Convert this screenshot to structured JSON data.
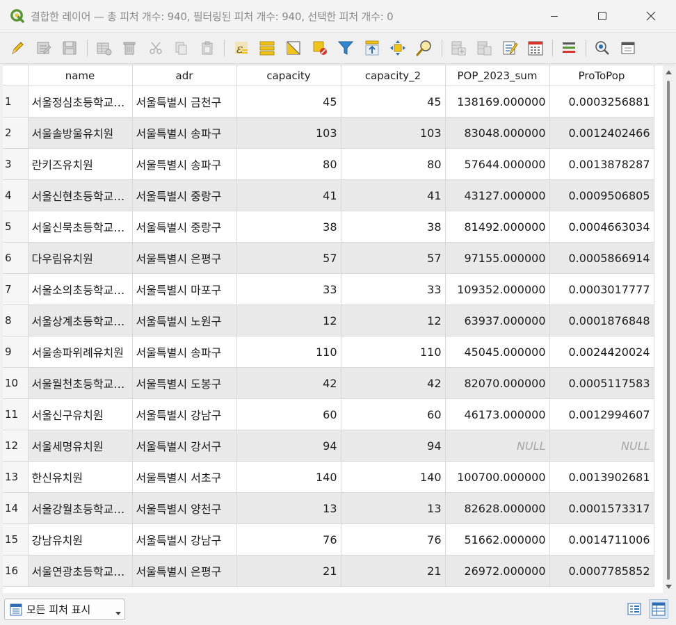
{
  "window": {
    "title": "결합한 레이어 — 총 피처 개수: 940, 필터링된 피처 개수: 940, 선택한 피처 개수: 0"
  },
  "toolbar": {
    "buttons": [
      {
        "id": "toggle-editing",
        "icon": "pencil-icon"
      },
      {
        "id": "toggle-multi-edit",
        "icon": "multi-edit-icon"
      },
      {
        "id": "save-edits",
        "icon": "save-icon"
      },
      {
        "id": "reload-table",
        "icon": "reload-icon"
      },
      {
        "id": "delete-features",
        "icon": "trash-icon"
      },
      {
        "id": "cut-features",
        "icon": "scissors-icon"
      },
      {
        "id": "copy-features",
        "icon": "copy-icon"
      },
      {
        "id": "paste-features",
        "icon": "paste-icon"
      },
      {
        "id": "select-by-expression",
        "icon": "expression-select-icon"
      },
      {
        "id": "select-all",
        "icon": "select-all-icon"
      },
      {
        "id": "invert-selection",
        "icon": "invert-selection-icon"
      },
      {
        "id": "deselect-all",
        "icon": "deselect-icon"
      },
      {
        "id": "filter-select",
        "icon": "filter-icon"
      },
      {
        "id": "move-selection-top",
        "icon": "move-top-icon"
      },
      {
        "id": "pan-to-selected",
        "icon": "pan-icon"
      },
      {
        "id": "zoom-to-selected",
        "icon": "zoom-icon"
      },
      {
        "id": "new-field",
        "icon": "new-field-icon"
      },
      {
        "id": "delete-field",
        "icon": "delete-field-icon"
      },
      {
        "id": "field-calculator",
        "icon": "field-calculator-icon"
      },
      {
        "id": "open-calculator",
        "icon": "calculator-icon"
      },
      {
        "id": "conditional-formatting",
        "icon": "conditional-format-icon"
      },
      {
        "id": "actions",
        "icon": "actions-icon"
      },
      {
        "id": "dock-table",
        "icon": "dock-icon"
      }
    ]
  },
  "table": {
    "columns": [
      "name",
      "adr",
      "capacity",
      "capacity_2",
      "POP_2023_sum",
      "ProToPop"
    ],
    "rows": [
      {
        "n": "1",
        "name": "서울정심초등학교병설유치원",
        "adr": "서울특별시 금천구",
        "capacity": "45",
        "capacity_2": "45",
        "pop": "138169.000000",
        "ratio": "0.0003256881"
      },
      {
        "n": "2",
        "name": "서울솔방울유치원",
        "adr": "서울특별시 송파구",
        "capacity": "103",
        "capacity_2": "103",
        "pop": "83048.000000",
        "ratio": "0.0012402466"
      },
      {
        "n": "3",
        "name": "란키즈유치원",
        "adr": "서울특별시 송파구",
        "capacity": "80",
        "capacity_2": "80",
        "pop": "57644.000000",
        "ratio": "0.0013878287"
      },
      {
        "n": "4",
        "name": "서울신현초등학교병설유치원",
        "adr": "서울특별시 중랑구",
        "capacity": "41",
        "capacity_2": "41",
        "pop": "43127.000000",
        "ratio": "0.0009506805"
      },
      {
        "n": "5",
        "name": "서울신묵초등학교병설유치원",
        "adr": "서울특별시 중랑구",
        "capacity": "38",
        "capacity_2": "38",
        "pop": "81492.000000",
        "ratio": "0.0004663034"
      },
      {
        "n": "6",
        "name": "다우림유치원",
        "adr": "서울특별시 은평구",
        "capacity": "57",
        "capacity_2": "57",
        "pop": "97155.000000",
        "ratio": "0.0005866914"
      },
      {
        "n": "7",
        "name": "서울소의초등학교병설유치원",
        "adr": "서울특별시 마포구",
        "capacity": "33",
        "capacity_2": "33",
        "pop": "109352.000000",
        "ratio": "0.0003017777"
      },
      {
        "n": "8",
        "name": "서울상계초등학교병설유치원",
        "adr": "서울특별시 노원구",
        "capacity": "12",
        "capacity_2": "12",
        "pop": "63937.000000",
        "ratio": "0.0001876848"
      },
      {
        "n": "9",
        "name": "서울송파위례유치원",
        "adr": "서울특별시 송파구",
        "capacity": "110",
        "capacity_2": "110",
        "pop": "45045.000000",
        "ratio": "0.0024420024"
      },
      {
        "n": "10",
        "name": "서울월천초등학교병설유치원",
        "adr": "서울특별시 도봉구",
        "capacity": "42",
        "capacity_2": "42",
        "pop": "82070.000000",
        "ratio": "0.0005117583"
      },
      {
        "n": "11",
        "name": "서울신구유치원",
        "adr": "서울특별시 강남구",
        "capacity": "60",
        "capacity_2": "60",
        "pop": "46173.000000",
        "ratio": "0.0012994607"
      },
      {
        "n": "12",
        "name": "서울세명유치원",
        "adr": "서울특별시 강서구",
        "capacity": "94",
        "capacity_2": "94",
        "pop": "NULL",
        "ratio": "NULL"
      },
      {
        "n": "13",
        "name": "한신유치원",
        "adr": "서울특별시 서초구",
        "capacity": "140",
        "capacity_2": "140",
        "pop": "100700.000000",
        "ratio": "0.0013902681"
      },
      {
        "n": "14",
        "name": "서울강월초등학교병설유치원",
        "adr": "서울특별시 양천구",
        "capacity": "13",
        "capacity_2": "13",
        "pop": "82628.000000",
        "ratio": "0.0001573317"
      },
      {
        "n": "15",
        "name": "강남유치원",
        "adr": "서울특별시 강남구",
        "capacity": "76",
        "capacity_2": "76",
        "pop": "51662.000000",
        "ratio": "0.0014711006"
      },
      {
        "n": "16",
        "name": "서울연광초등학교병설유치원",
        "adr": "서울특별시 은평구",
        "capacity": "21",
        "capacity_2": "21",
        "pop": "26972.000000",
        "ratio": "0.0007785852"
      }
    ]
  },
  "footer": {
    "filter_label": "모든 피처 표시"
  },
  "colors": {
    "alt_row": "#e9e9e9",
    "qgis_green": "#589632",
    "qgis_yellow": "#f0c418",
    "icon_blue": "#2f6db5"
  }
}
